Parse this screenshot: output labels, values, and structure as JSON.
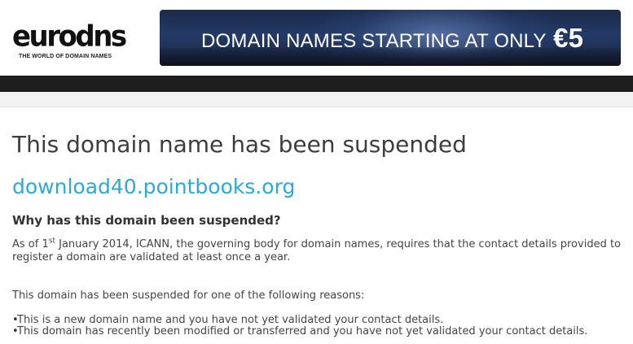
{
  "header": {
    "logo_text": "eurodns",
    "logo_tagline": "THE WORLD OF DOMAIN NAMES",
    "banner_text": "DOMAIN NAMES STARTING AT ONLY ",
    "banner_price": "€5"
  },
  "main": {
    "title": "This domain name has been suspended",
    "domain_name": "download40.pointbooks.org",
    "question": "Why has this domain been suspended?",
    "paragraph1_prefix": "As of 1",
    "paragraph1_sup": "st",
    "paragraph1_rest": " January 2014, ICANN, the governing body for domain names, requires that the contact details provided to register a domain are validated at least once a year.",
    "paragraph2": "This domain has been suspended for one of the following reasons:",
    "reasons": [
      "This is a new domain name and you have not yet validated your contact details.",
      "This domain has recently been modified or transferred and you have not yet validated your contact details."
    ],
    "bullet": "•"
  },
  "colors": {
    "link": "#2ba9d8",
    "navbar": "#1e1e1e",
    "title": "#3d3d3d"
  }
}
